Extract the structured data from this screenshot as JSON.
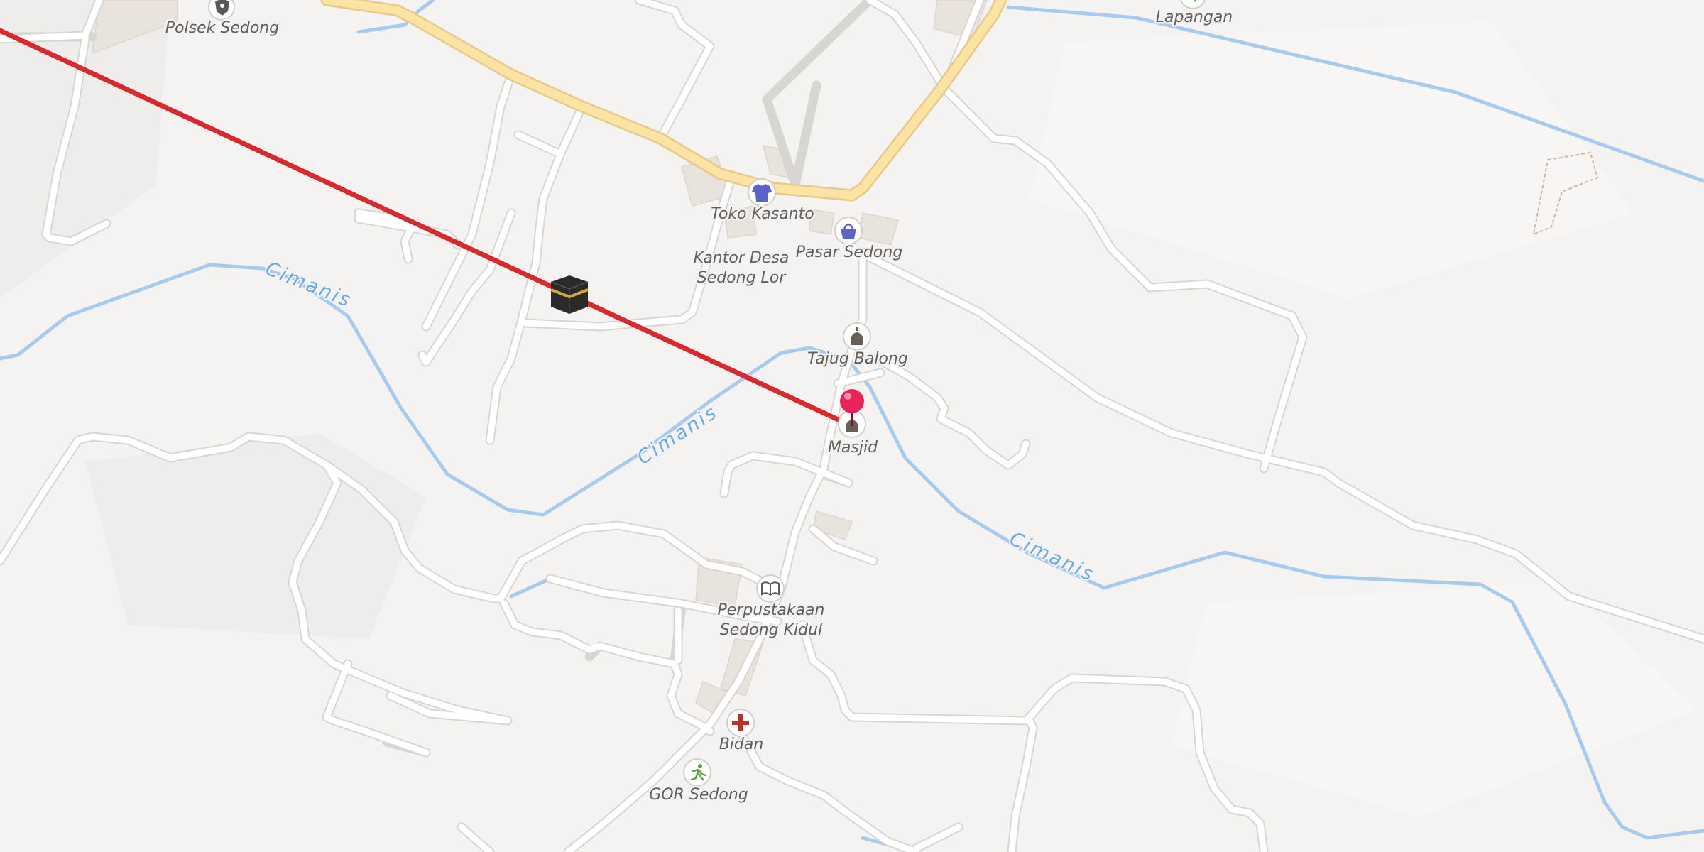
{
  "map": {
    "colors": {
      "background": "#f5f3f1",
      "road": "#ffffff",
      "main_road": "#fbe3a3",
      "river": "#a7cbef",
      "qibla_line": "#d8292f",
      "pin": "#e8245a"
    },
    "river_name": "Cimanis",
    "places": [
      {
        "name": "Polsek Sedong",
        "icon": "police-icon"
      },
      {
        "name": "Lapangan",
        "icon": "pitch-icon"
      },
      {
        "name": "Toko Kasanto",
        "icon": "clothes-shop-icon"
      },
      {
        "name": "Pasar Sedong",
        "icon": "market-basket-icon"
      },
      {
        "name_line1": "Kantor Desa",
        "name_line2": "Sedong Lor"
      },
      {
        "name": "Tajug Balong",
        "icon": "mosque-icon"
      },
      {
        "name": "Masjid",
        "icon": "mosque-icon"
      },
      {
        "name_line1": "Perpustakaan",
        "name_line2": "Sedong Kidul",
        "icon": "library-book-icon"
      },
      {
        "name": "Bidan",
        "icon": "medical-cross-icon"
      },
      {
        "name": "GOR Sedong",
        "icon": "sports-centre-icon"
      }
    ],
    "qibla": {
      "icon": "kaaba-icon"
    },
    "location_pin": {
      "icon": "location-pin-icon"
    }
  }
}
